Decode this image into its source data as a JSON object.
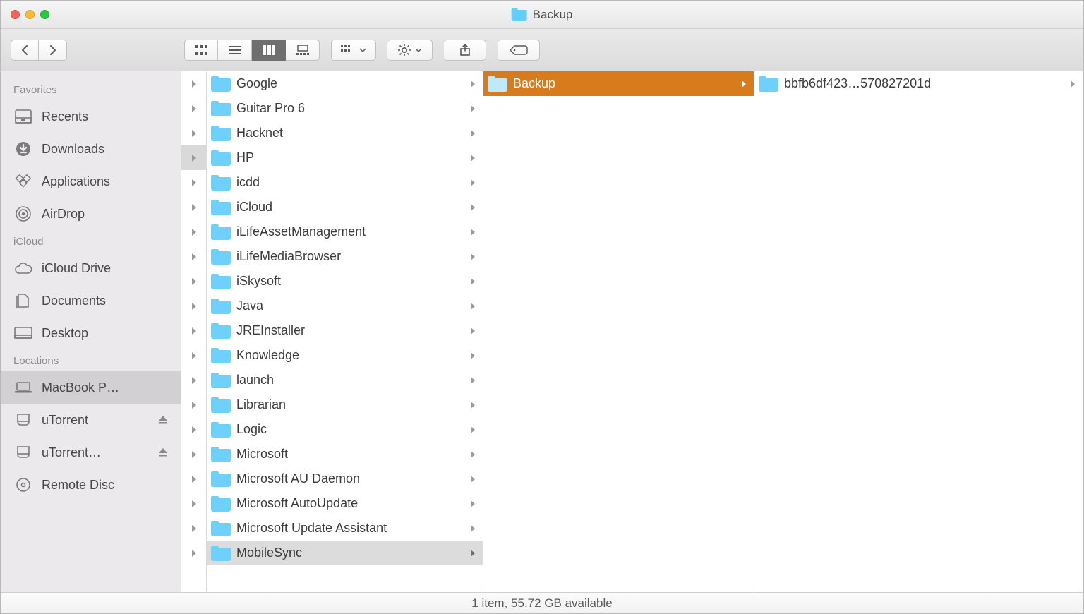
{
  "window": {
    "title": "Backup"
  },
  "sidebar": {
    "sections": [
      {
        "heading": "Favorites",
        "items": [
          {
            "icon": "recents-icon",
            "label": "Recents",
            "eject": false,
            "selected": false
          },
          {
            "icon": "downloads-icon",
            "label": "Downloads",
            "eject": false,
            "selected": false
          },
          {
            "icon": "applications-icon",
            "label": "Applications",
            "eject": false,
            "selected": false
          },
          {
            "icon": "airdrop-icon",
            "label": "AirDrop",
            "eject": false,
            "selected": false
          }
        ]
      },
      {
        "heading": "iCloud",
        "items": [
          {
            "icon": "icloud-icon",
            "label": "iCloud Drive",
            "eject": false,
            "selected": false
          },
          {
            "icon": "documents-icon",
            "label": "Documents",
            "eject": false,
            "selected": false
          },
          {
            "icon": "desktop-icon",
            "label": "Desktop",
            "eject": false,
            "selected": false
          }
        ]
      },
      {
        "heading": "Locations",
        "items": [
          {
            "icon": "laptop-icon",
            "label": "MacBook P…",
            "eject": false,
            "selected": true
          },
          {
            "icon": "disk-icon",
            "label": "uTorrent",
            "eject": true,
            "selected": false
          },
          {
            "icon": "disk-icon",
            "label": "uTorrent…",
            "eject": true,
            "selected": false
          },
          {
            "icon": "optical-icon",
            "label": "Remote Disc",
            "eject": false,
            "selected": false
          }
        ]
      }
    ]
  },
  "columns": {
    "col0_rows": 20,
    "col0_selected_index": 3,
    "col1": [
      {
        "name": "Google",
        "selected": false
      },
      {
        "name": "Guitar Pro 6",
        "selected": false
      },
      {
        "name": "Hacknet",
        "selected": false
      },
      {
        "name": "HP",
        "selected": false
      },
      {
        "name": "icdd",
        "selected": false
      },
      {
        "name": "iCloud",
        "selected": false
      },
      {
        "name": "iLifeAssetManagement",
        "selected": false
      },
      {
        "name": "iLifeMediaBrowser",
        "selected": false
      },
      {
        "name": "iSkysoft",
        "selected": false
      },
      {
        "name": "Java",
        "selected": false
      },
      {
        "name": "JREInstaller",
        "selected": false
      },
      {
        "name": "Knowledge",
        "selected": false
      },
      {
        "name": "launch",
        "selected": false
      },
      {
        "name": "Librarian",
        "selected": false
      },
      {
        "name": "Logic",
        "selected": false
      },
      {
        "name": "Microsoft",
        "selected": false
      },
      {
        "name": "Microsoft AU Daemon",
        "selected": false
      },
      {
        "name": "Microsoft AutoUpdate",
        "selected": false
      },
      {
        "name": "Microsoft Update Assistant",
        "selected": false
      },
      {
        "name": "MobileSync",
        "selected": true
      }
    ],
    "col2": [
      {
        "name": "Backup",
        "selected": true
      }
    ],
    "col3": [
      {
        "name": "bbfb6df423…570827201d",
        "selected": false
      }
    ]
  },
  "statusbar": "1 item, 55.72 GB available"
}
